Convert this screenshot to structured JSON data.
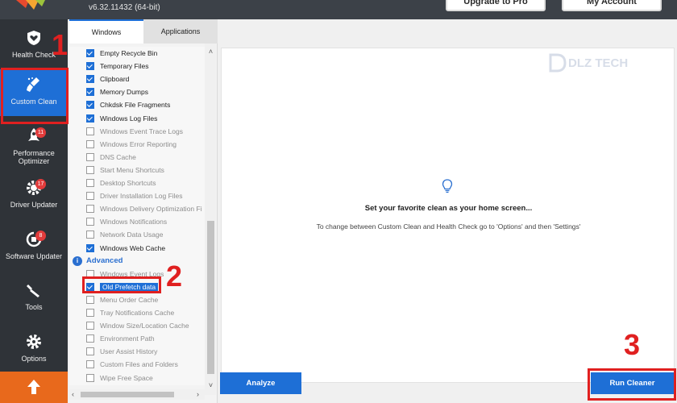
{
  "app": {
    "version": "v6.32.11432 (64-bit)",
    "upgrade_label": "Upgrade to Pro",
    "account_label": "My Account"
  },
  "sidebar": {
    "items": [
      {
        "label": "Health Check",
        "icon": "heart-shield-icon"
      },
      {
        "label": "Custom Clean",
        "icon": "brush-icon"
      },
      {
        "label": "Performance Optimizer",
        "icon": "rocket-icon",
        "badge": "11"
      },
      {
        "label": "Driver Updater",
        "icon": "gear-chip-icon",
        "badge": "17"
      },
      {
        "label": "Software Updater",
        "icon": "refresh-icon",
        "badge": "8"
      },
      {
        "label": "Tools",
        "icon": "wrench-icon"
      },
      {
        "label": "Options",
        "icon": "gear-icon"
      }
    ],
    "upgrade_icon": "arrow-up-icon"
  },
  "tabs": {
    "windows": "Windows",
    "applications": "Applications"
  },
  "list": {
    "items": [
      {
        "label": "Empty Recycle Bin",
        "checked": true
      },
      {
        "label": "Temporary Files",
        "checked": true
      },
      {
        "label": "Clipboard",
        "checked": true
      },
      {
        "label": "Memory Dumps",
        "checked": true
      },
      {
        "label": "Chkdsk File Fragments",
        "checked": true
      },
      {
        "label": "Windows Log Files",
        "checked": true
      },
      {
        "label": "Windows Event Trace Logs",
        "checked": false
      },
      {
        "label": "Windows Error Reporting",
        "checked": false
      },
      {
        "label": "DNS Cache",
        "checked": false
      },
      {
        "label": "Start Menu Shortcuts",
        "checked": false
      },
      {
        "label": "Desktop Shortcuts",
        "checked": false
      },
      {
        "label": "Driver Installation Log Files",
        "checked": false
      },
      {
        "label": "Windows Delivery Optimization Fi",
        "checked": false
      },
      {
        "label": "Windows Notifications",
        "checked": false
      },
      {
        "label": "Network Data Usage",
        "checked": false
      },
      {
        "label": "Windows Web Cache",
        "checked": true
      }
    ],
    "advanced_label": "Advanced",
    "advanced_items": [
      {
        "label": "Windows Event Logs",
        "checked": false
      },
      {
        "label": "Old Prefetch data",
        "checked": true,
        "selected": true
      },
      {
        "label": "Menu Order Cache",
        "checked": false
      },
      {
        "label": "Tray Notifications Cache",
        "checked": false
      },
      {
        "label": "Window Size/Location Cache",
        "checked": false
      },
      {
        "label": "Environment Path",
        "checked": false
      },
      {
        "label": "User Assist History",
        "checked": false
      },
      {
        "label": "Custom Files and Folders",
        "checked": false
      },
      {
        "label": "Wipe Free Space",
        "checked": false
      }
    ]
  },
  "main": {
    "watermark": "DLZ TECH",
    "title": "Set your favorite clean as your home screen...",
    "subtitle": "To change between Custom Clean and Health Check go to 'Options' and then 'Settings'",
    "analyze_label": "Analyze",
    "run_label": "Run Cleaner"
  },
  "annotations": [
    "1",
    "2",
    "3"
  ],
  "colors": {
    "accent": "#1e6fd6",
    "annotation": "#e02020",
    "upgrade": "#e8691c",
    "sidebar": "#2f3338"
  }
}
